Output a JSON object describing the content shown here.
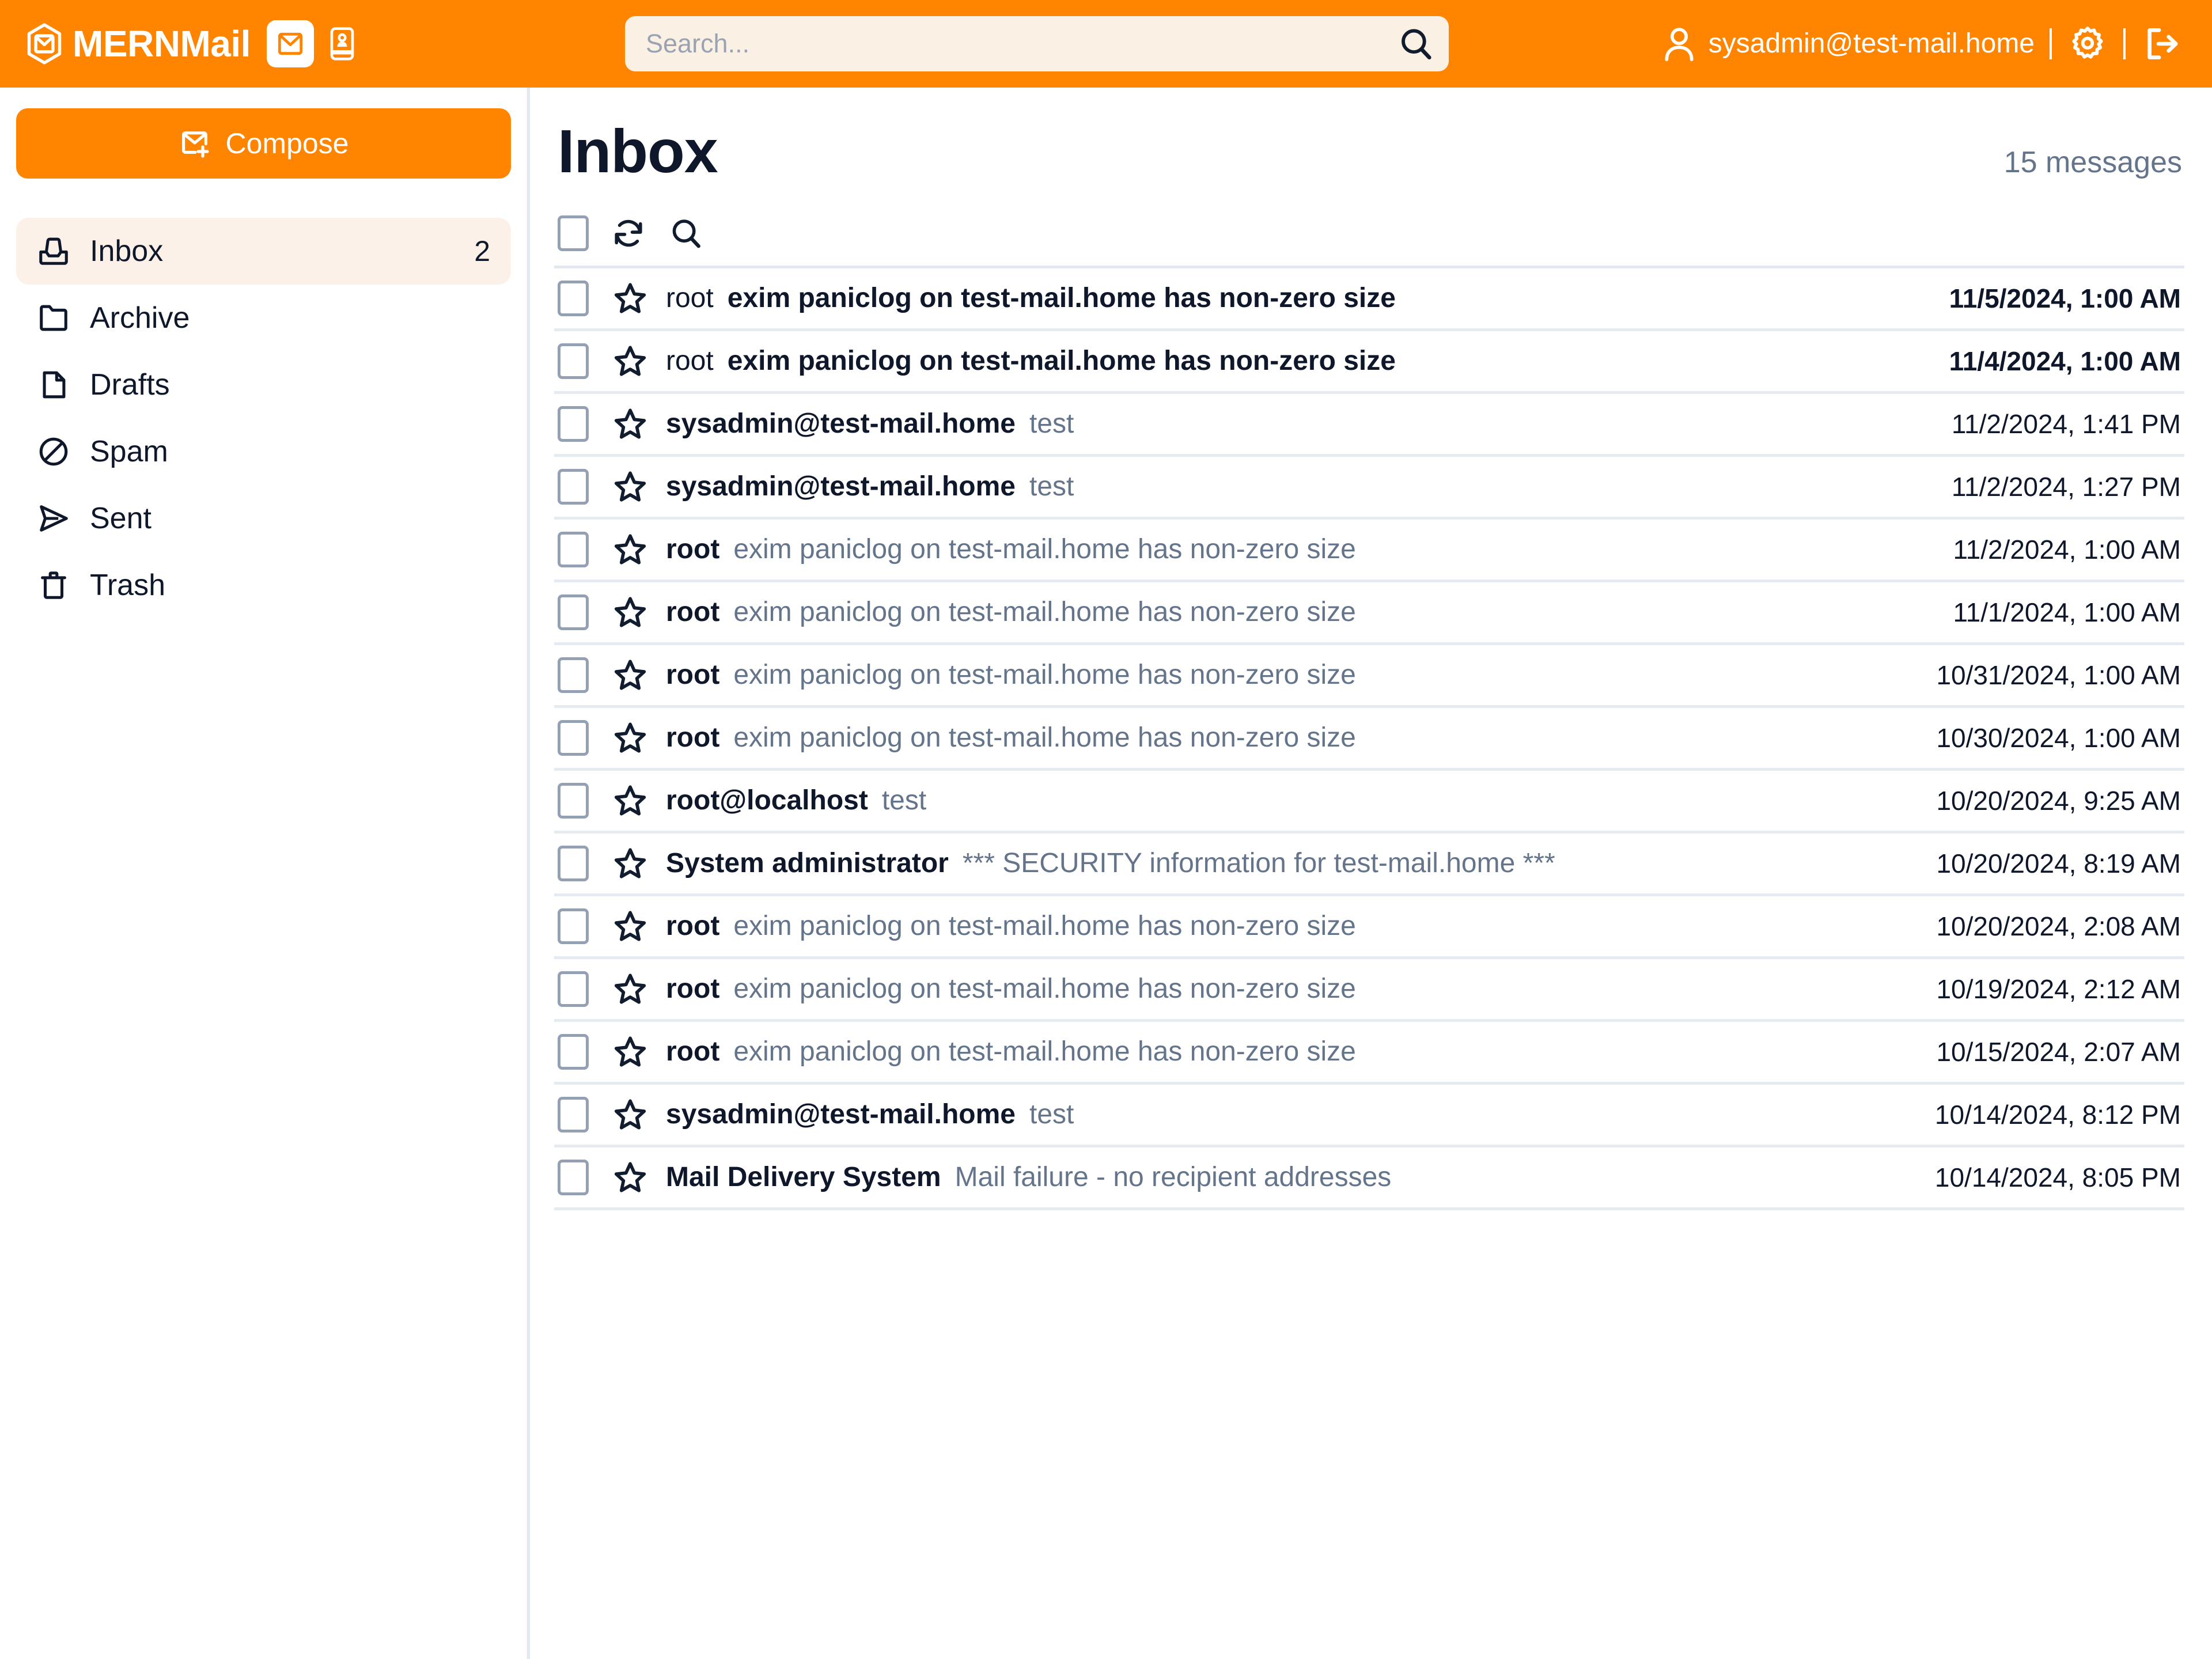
{
  "brand": {
    "name": "MERNMail",
    "logo_icon": "mail-box-logo-icon",
    "mail_button_icon": "envelope-icon",
    "contacts_button_icon": "address-book-icon"
  },
  "search": {
    "placeholder": "Search...",
    "value": "",
    "icon": "search-icon"
  },
  "account": {
    "email": "sysadmin@test-mail.home",
    "avatar_icon": "person-icon",
    "settings_icon": "gear-icon",
    "logout_icon": "logout-icon"
  },
  "colors": {
    "accent": "#ff8400",
    "accent_text": "#ffffff",
    "selected_bg": "#fbf1e8",
    "search_bg": "#fbf0e4",
    "text": "#0f172a",
    "muted": "#64748b",
    "divider": "#e2e8f0"
  },
  "sidebar": {
    "compose": {
      "label": "Compose",
      "icon": "compose-envelope-plus-icon"
    },
    "items": [
      {
        "label": "Inbox",
        "icon": "inbox-tray-icon",
        "count": "2",
        "active": true
      },
      {
        "label": "Archive",
        "icon": "folder-icon",
        "count": "",
        "active": false
      },
      {
        "label": "Drafts",
        "icon": "file-icon",
        "count": "",
        "active": false
      },
      {
        "label": "Spam",
        "icon": "ban-circle-icon",
        "count": "",
        "active": false
      },
      {
        "label": "Sent",
        "icon": "paper-plane-icon",
        "count": "",
        "active": false
      },
      {
        "label": "Trash",
        "icon": "trash-can-icon",
        "count": "",
        "active": false
      }
    ]
  },
  "main": {
    "title": "Inbox",
    "message_count_label": "15 messages",
    "toolbar": {
      "select_all_checked": false,
      "refresh_icon": "refresh-icon",
      "search_icon": "search-icon"
    },
    "messages": [
      {
        "sender": "root",
        "subject": "exim paniclog on test-mail.home has non-zero size",
        "date": "11/5/2024, 1:00 AM",
        "unread": true,
        "starred": false,
        "checked": false
      },
      {
        "sender": "root",
        "subject": "exim paniclog on test-mail.home has non-zero size",
        "date": "11/4/2024, 1:00 AM",
        "unread": true,
        "starred": false,
        "checked": false
      },
      {
        "sender": "sysadmin@test-mail.home",
        "subject": "test",
        "date": "11/2/2024, 1:41 PM",
        "unread": false,
        "starred": false,
        "checked": false
      },
      {
        "sender": "sysadmin@test-mail.home",
        "subject": "test",
        "date": "11/2/2024, 1:27 PM",
        "unread": false,
        "starred": false,
        "checked": false
      },
      {
        "sender": "root",
        "subject": "exim paniclog on test-mail.home has non-zero size",
        "date": "11/2/2024, 1:00 AM",
        "unread": false,
        "starred": false,
        "checked": false
      },
      {
        "sender": "root",
        "subject": "exim paniclog on test-mail.home has non-zero size",
        "date": "11/1/2024, 1:00 AM",
        "unread": false,
        "starred": false,
        "checked": false
      },
      {
        "sender": "root",
        "subject": "exim paniclog on test-mail.home has non-zero size",
        "date": "10/31/2024, 1:00 AM",
        "unread": false,
        "starred": false,
        "checked": false
      },
      {
        "sender": "root",
        "subject": "exim paniclog on test-mail.home has non-zero size",
        "date": "10/30/2024, 1:00 AM",
        "unread": false,
        "starred": false,
        "checked": false
      },
      {
        "sender": "root@localhost",
        "subject": "test",
        "date": "10/20/2024, 9:25 AM",
        "unread": false,
        "starred": false,
        "checked": false
      },
      {
        "sender": "System administrator",
        "subject": "*** SECURITY information for test-mail.home ***",
        "date": "10/20/2024, 8:19 AM",
        "unread": false,
        "starred": false,
        "checked": false
      },
      {
        "sender": "root",
        "subject": "exim paniclog on test-mail.home has non-zero size",
        "date": "10/20/2024, 2:08 AM",
        "unread": false,
        "starred": false,
        "checked": false
      },
      {
        "sender": "root",
        "subject": "exim paniclog on test-mail.home has non-zero size",
        "date": "10/19/2024, 2:12 AM",
        "unread": false,
        "starred": false,
        "checked": false
      },
      {
        "sender": "root",
        "subject": "exim paniclog on test-mail.home has non-zero size",
        "date": "10/15/2024, 2:07 AM",
        "unread": false,
        "starred": false,
        "checked": false
      },
      {
        "sender": "sysadmin@test-mail.home",
        "subject": "test",
        "date": "10/14/2024, 8:12 PM",
        "unread": false,
        "starred": false,
        "checked": false
      },
      {
        "sender": "Mail Delivery System",
        "subject": "Mail failure - no recipient addresses",
        "date": "10/14/2024, 8:05 PM",
        "unread": false,
        "starred": false,
        "checked": false
      }
    ]
  }
}
